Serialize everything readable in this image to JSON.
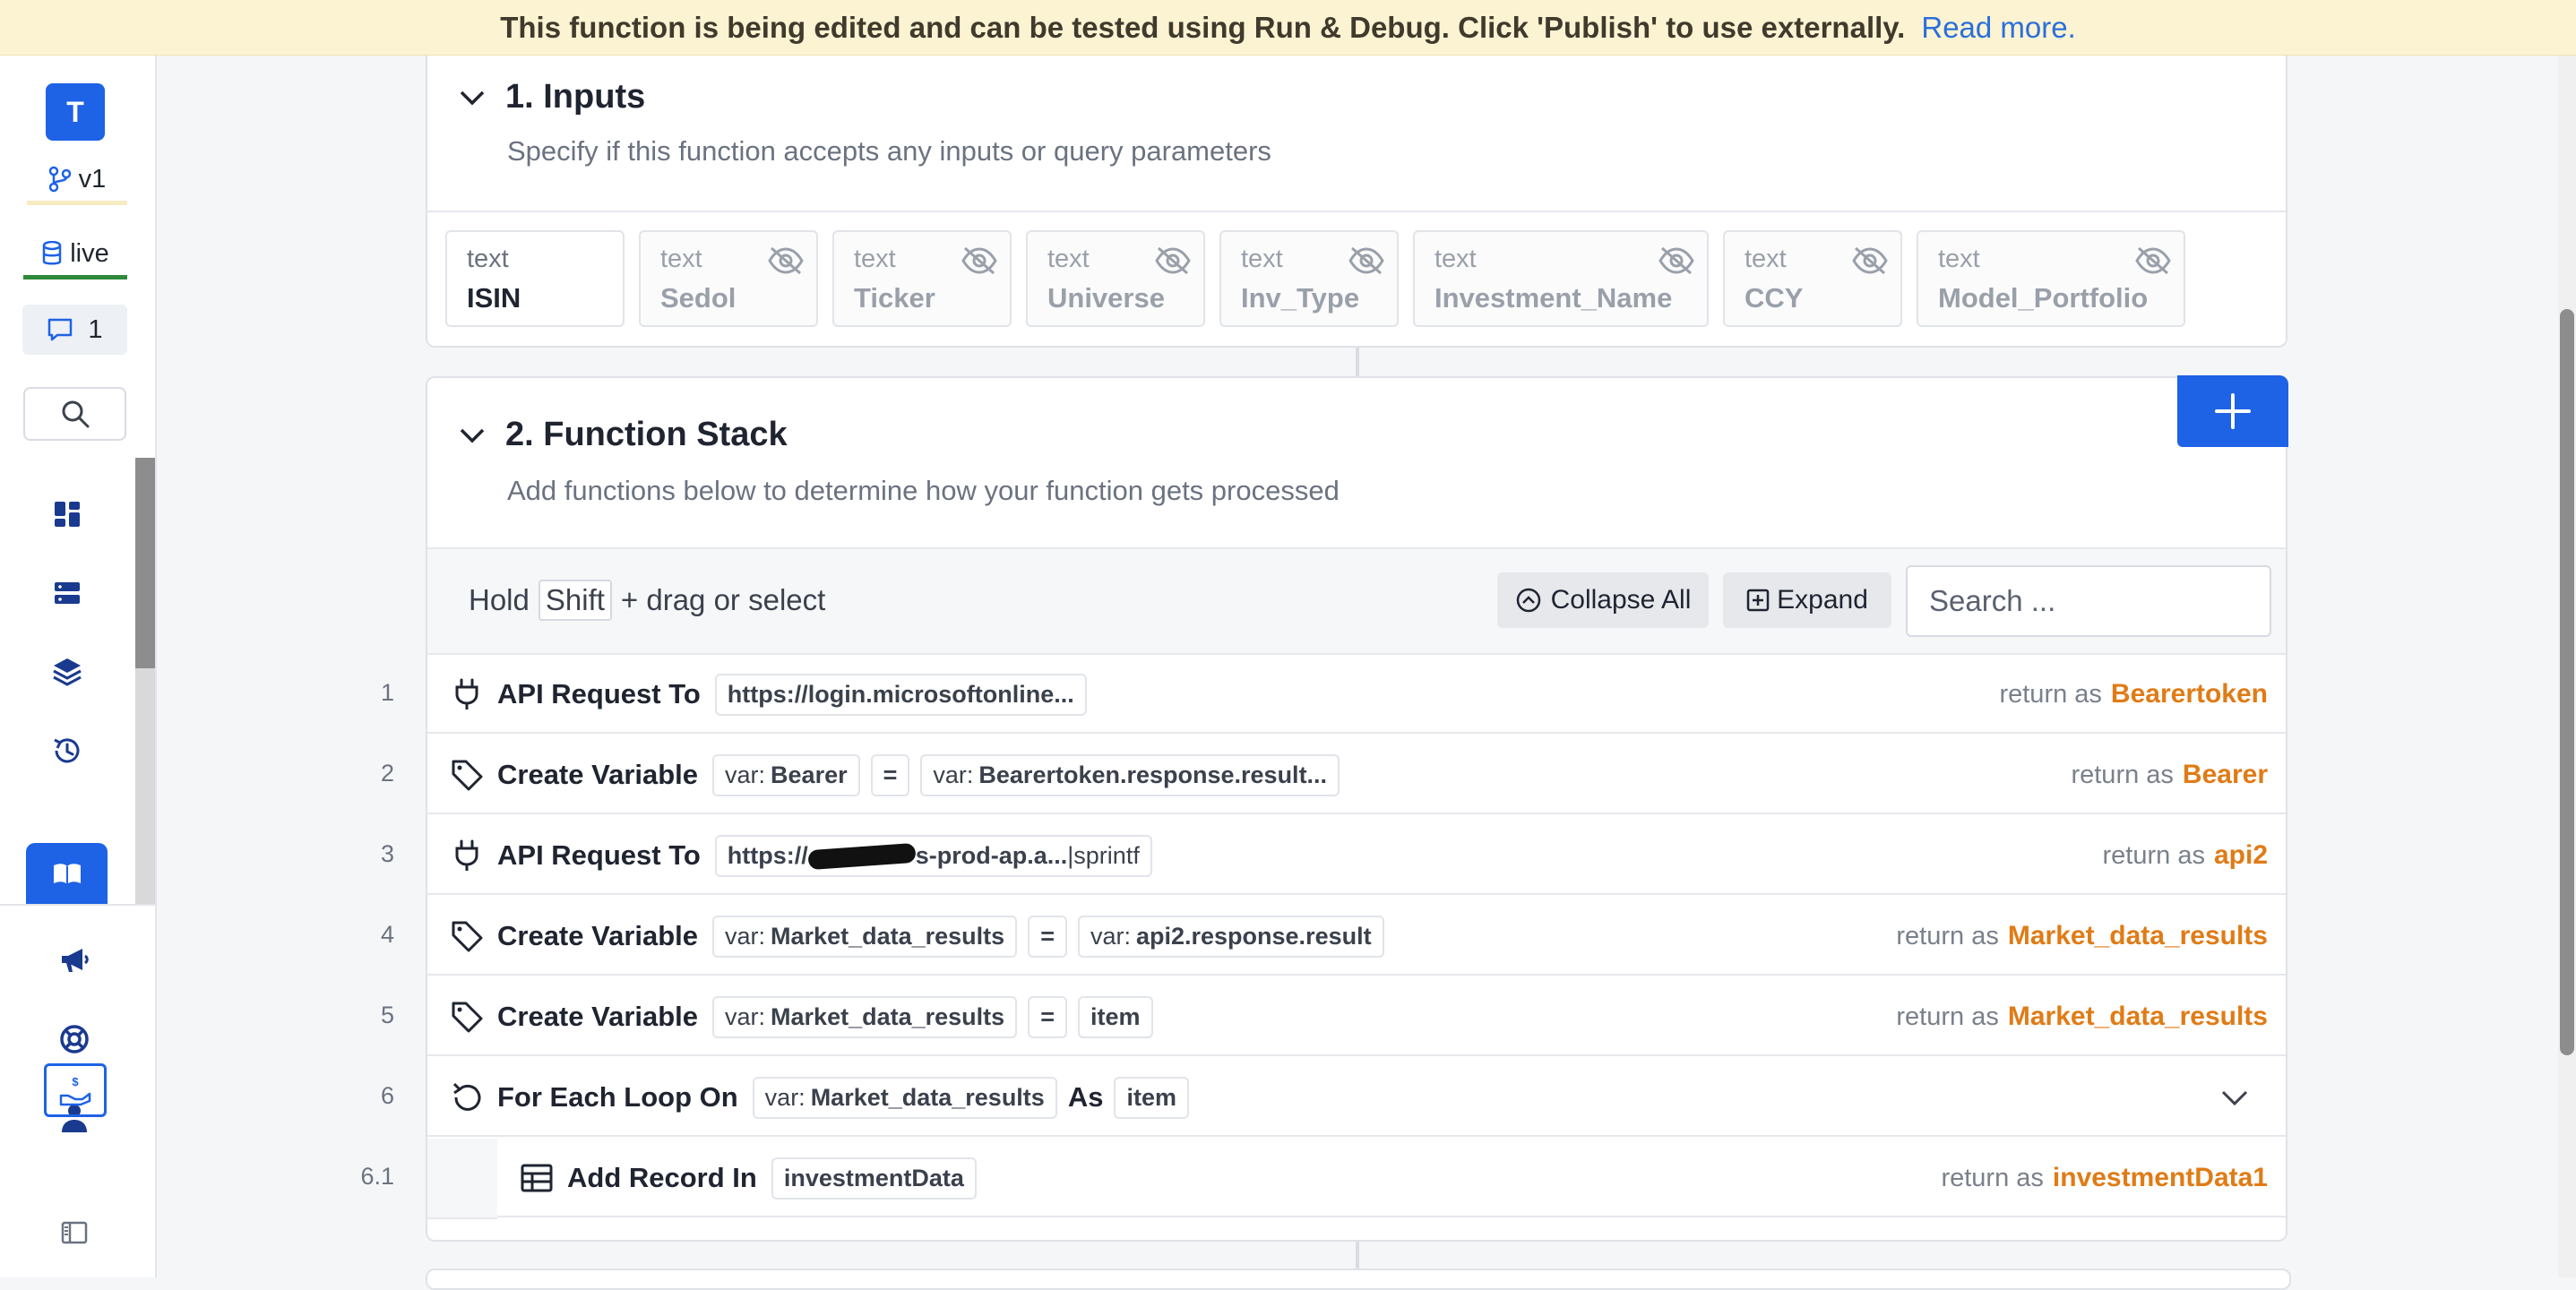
{
  "banner": {
    "text": "This function is being edited and can be tested using Run & Debug. Click 'Publish' to use externally.",
    "link": "Read more."
  },
  "sidebar": {
    "avatar": "T",
    "version": "v1",
    "environment": "live",
    "comments_count": "1",
    "icons": [
      "dashboard-icon",
      "database-icon",
      "layers-icon",
      "history-icon",
      "library-icon",
      "megaphone-icon",
      "help-icon",
      "user-icon",
      "billing-icon",
      "sidebar-toggle-icon"
    ]
  },
  "inputs": {
    "title": "1. Inputs",
    "subtitle": "Specify if this function accepts any inputs or query parameters",
    "items": [
      {
        "type": "text",
        "name": "ISIN",
        "hidden": false
      },
      {
        "type": "text",
        "name": "Sedol",
        "hidden": true
      },
      {
        "type": "text",
        "name": "Ticker",
        "hidden": true
      },
      {
        "type": "text",
        "name": "Universe",
        "hidden": true
      },
      {
        "type": "text",
        "name": "Inv_Type",
        "hidden": true
      },
      {
        "type": "text",
        "name": "Investment_Name",
        "hidden": true
      },
      {
        "type": "text",
        "name": "CCY",
        "hidden": true
      },
      {
        "type": "text",
        "name": "Model_Portfolio",
        "hidden": true
      }
    ]
  },
  "stack": {
    "title": "2. Function Stack",
    "subtitle": "Add functions below to determine how your function gets processed",
    "toolbar": {
      "hint_prefix": "Hold",
      "hint_key": "Shift",
      "hint_suffix": "+ drag or select",
      "collapse_label": "Collapse All",
      "expand_label": "Expand",
      "search_placeholder": "Search ..."
    },
    "rows": [
      {
        "num": "1",
        "icon": "plug-icon",
        "title": "API Request To",
        "chips": [
          "https://login.microsoftonline..."
        ],
        "return_label": "return as",
        "return_var": "Bearertoken"
      },
      {
        "num": "2",
        "icon": "tag-icon",
        "title": "Create Variable",
        "chip_var_prefix": "var:",
        "chip_var": "Bearer",
        "eq": "=",
        "chip_val_prefix": "var:",
        "chip_val": "Bearertoken.response.result...",
        "return_label": "return as",
        "return_var": "Bearer"
      },
      {
        "num": "3",
        "icon": "plug-icon",
        "title": "API Request To",
        "chip_url_a": "https://",
        "chip_url_b": "s-prod-ap.a...",
        "chip_url_c": "|sprintf",
        "return_label": "return as",
        "return_var": "api2"
      },
      {
        "num": "4",
        "icon": "tag-icon",
        "title": "Create Variable",
        "chip_var_prefix": "var:",
        "chip_var": "Market_data_results",
        "eq": "=",
        "chip_val_prefix": "var:",
        "chip_val": "api2.response.result",
        "return_label": "return as",
        "return_var": "Market_data_results"
      },
      {
        "num": "5",
        "icon": "tag-icon",
        "title": "Create Variable",
        "chip_var_prefix": "var:",
        "chip_var": "Market_data_results",
        "eq": "=",
        "chip_val": "item",
        "return_label": "return as",
        "return_var": "Market_data_results"
      },
      {
        "num": "6",
        "icon": "loop-icon",
        "title": "For Each Loop On",
        "chip_val_prefix": "var:",
        "chip_val": "Market_data_results",
        "as_label": "As",
        "chip_item": "item"
      },
      {
        "num": "6.1",
        "icon": "table-icon",
        "title": "Add Record In",
        "chip_val": "investmentData",
        "return_label": "return as",
        "return_var": "investmentData1"
      }
    ]
  },
  "colors": {
    "accent": "#1e62e6",
    "return_var": "#e07b16",
    "banner_bg": "#fcf3d2",
    "env_live": "#2e8a3a"
  }
}
